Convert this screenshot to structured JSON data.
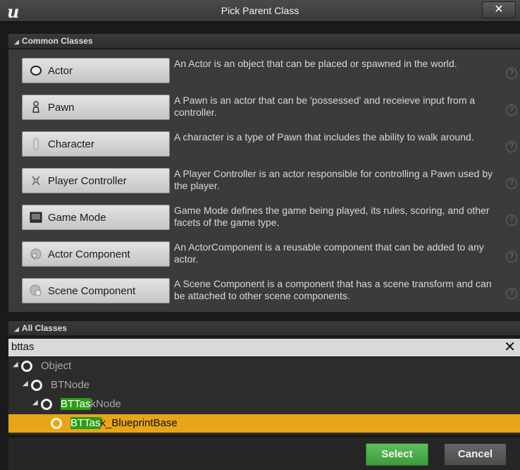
{
  "window": {
    "title": "Pick Parent Class",
    "close_label": "✕"
  },
  "common": {
    "header": "Common Classes",
    "items": [
      {
        "label": "Actor",
        "icon": "actor-icon",
        "description": "An Actor is an object that can be placed or spawned in the world."
      },
      {
        "label": "Pawn",
        "icon": "pawn-icon",
        "description": "A Pawn is an actor that can be 'possessed' and receieve input from a controller."
      },
      {
        "label": "Character",
        "icon": "character-icon",
        "description": "A character is a type of Pawn that includes the ability to walk around."
      },
      {
        "label": "Player Controller",
        "icon": "player-controller-icon",
        "description": "A Player Controller is an actor responsible for controlling a Pawn used by the player."
      },
      {
        "label": "Game Mode",
        "icon": "game-mode-icon",
        "description": "Game Mode defines the game being played, its rules, scoring, and other facets of the game type."
      },
      {
        "label": "Actor Component",
        "icon": "actor-component-icon",
        "description": "An ActorComponent is a reusable component that can be added to any actor."
      },
      {
        "label": "Scene Component",
        "icon": "scene-component-icon",
        "description": "A Scene Component is a component that has a scene transform and can be attached to other scene components."
      }
    ],
    "help_glyph": "?"
  },
  "all": {
    "header": "All Classes",
    "search_value": "bttas",
    "clear_glyph": "✕",
    "tree": [
      {
        "name": "Object",
        "match": "",
        "rest": "Object"
      },
      {
        "name": "BTNode",
        "match": "",
        "rest": "BTNode"
      },
      {
        "name": "BTTaskNode",
        "match": "BTTas",
        "rest": "kNode"
      },
      {
        "name": "BTTask_BlueprintBase",
        "match": "BTTas",
        "rest": "k_BlueprintBase",
        "selected": true
      }
    ]
  },
  "footer": {
    "select_label": "Select",
    "cancel_label": "Cancel"
  },
  "colors": {
    "highlight": "#2e9c16",
    "selection": "#e8a51a",
    "select_button": "#4fae4c"
  }
}
